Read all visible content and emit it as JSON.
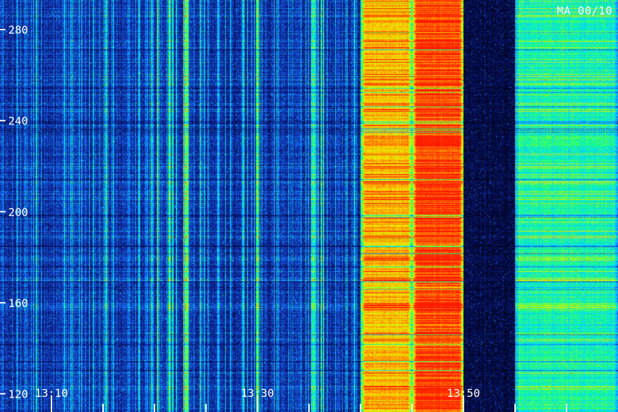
{
  "title": "MA 00/10",
  "chart_data": {
    "type": "heatmap",
    "title": "MA 00/10",
    "xlabel": "",
    "ylabel": "",
    "y_ticks": [
      120,
      160,
      200,
      240,
      280
    ],
    "y_range": [
      112,
      293
    ],
    "x_ticks": [
      "13:10",
      "13:30",
      "13:50"
    ],
    "x_range": [
      "13:05",
      "14:05"
    ],
    "x_minor_tick_step_minutes": 5,
    "colormap": [
      "#000010",
      "#0a1a80",
      "#1a6cff",
      "#00e0ff",
      "#20ff70",
      "#c8ff00",
      "#ffd000",
      "#ff7000",
      "#ff1a00"
    ],
    "bursts": [
      {
        "start": "13:40",
        "end": "13:45",
        "level": 0.78
      },
      {
        "start": "13:45",
        "end": "13:50",
        "level": 0.96
      },
      {
        "start": "13:55",
        "end": "14:05",
        "level": 0.45
      }
    ],
    "quiet_interval": {
      "start": "13:50",
      "end": "13:55"
    },
    "grid": false,
    "legend": "none"
  }
}
